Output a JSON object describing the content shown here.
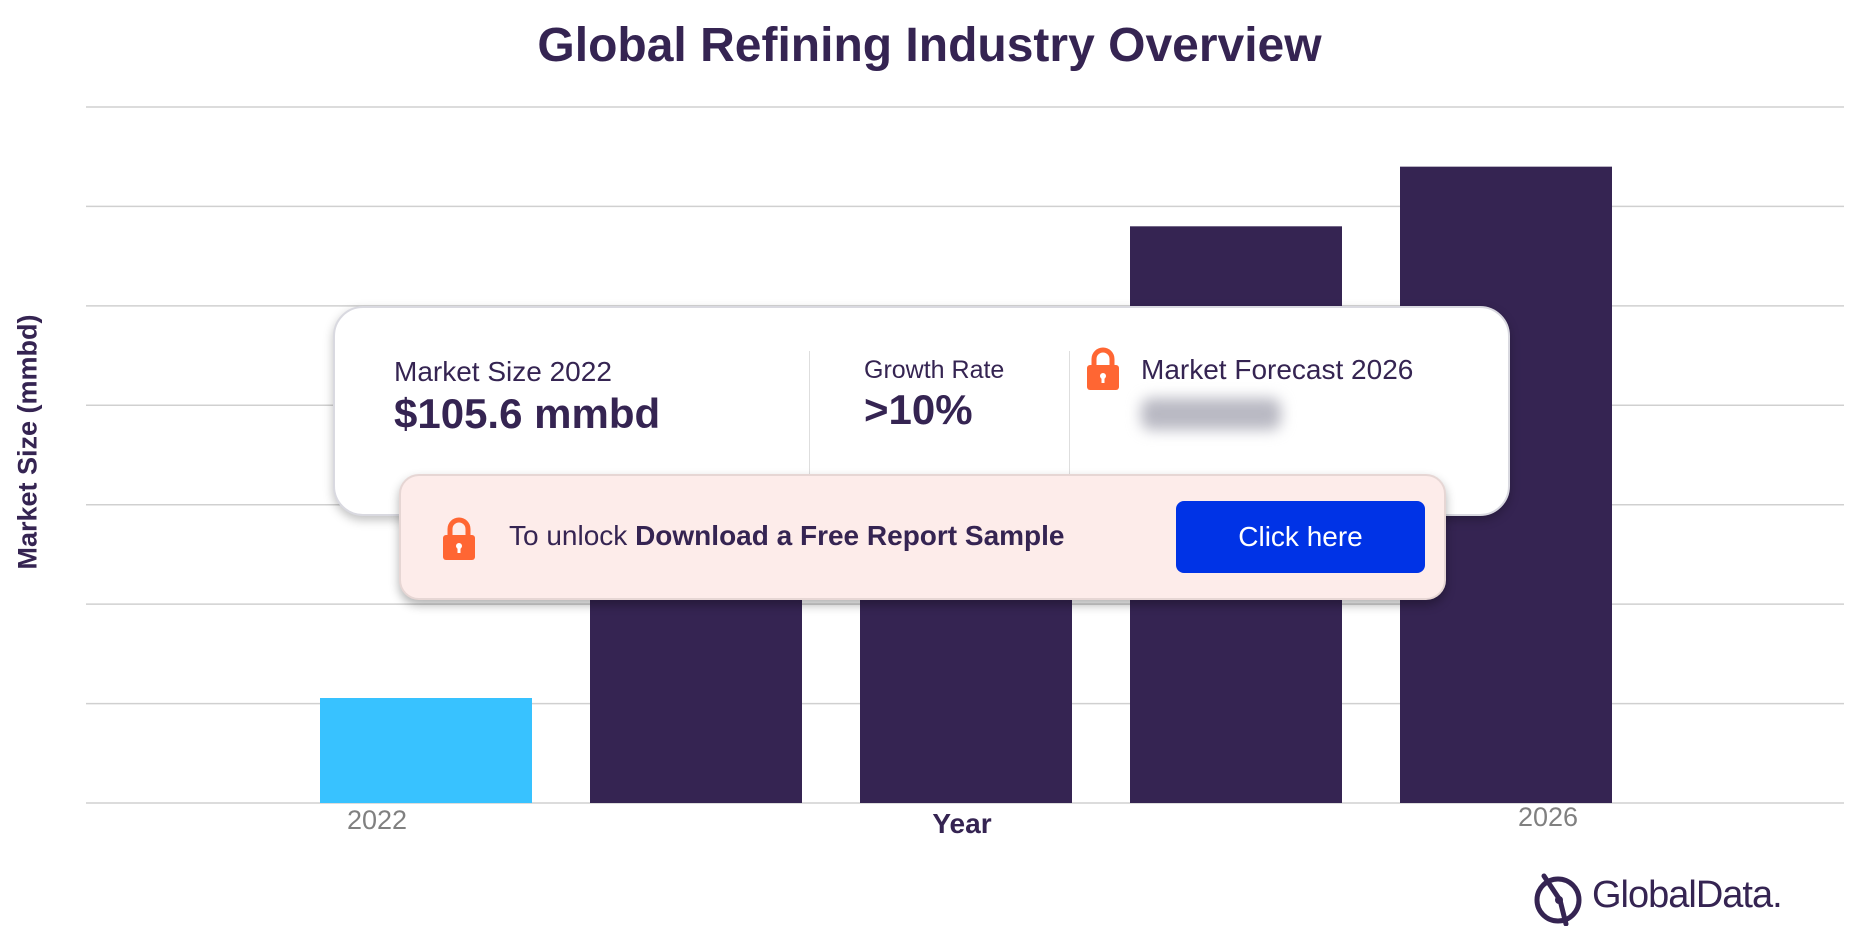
{
  "chart_data": {
    "type": "bar",
    "title": "Global Refining Industry Overview",
    "xlabel": "Year",
    "ylabel": "Market Size (mmbd)",
    "categories": [
      "2022",
      "",
      "",
      "",
      "2026"
    ],
    "tick_labels": [
      "2022",
      "2026"
    ],
    "values": [
      105.6,
      475,
      475,
      580,
      640
    ],
    "ylim": [
      0,
      700
    ],
    "grid": true,
    "highlight_index": 0,
    "colors": {
      "highlight": "#38c2ff",
      "bar": "#352452",
      "grid": "#d0d0d0"
    }
  },
  "card": {
    "market_size_label": "Market Size 2022",
    "market_size_value": "$105.6 mmbd",
    "growth_rate_label": "Growth Rate",
    "growth_rate_value": ">10%",
    "forecast_label": "Market Forecast 2026"
  },
  "unlock": {
    "prefix": "To unlock ",
    "bold": "Download a Free Report Sample",
    "button_label": "Click here"
  },
  "brand": {
    "name": "GlobalData."
  },
  "colors": {
    "accent_orange": "#ff6633",
    "button_blue": "#0033e6",
    "panel_pink": "#fdecea"
  },
  "icons": [
    "lock-icon",
    "globaldata-logo-icon"
  ]
}
